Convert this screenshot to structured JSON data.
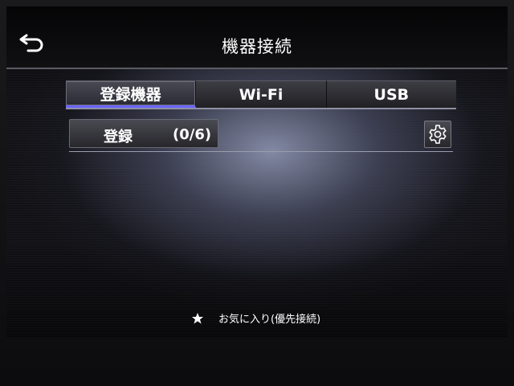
{
  "header": {
    "title": "機器接続",
    "back_icon": "back-arrow-icon"
  },
  "tabs": [
    {
      "label": "登録機器",
      "active": true
    },
    {
      "label": "Wi-Fi",
      "active": false
    },
    {
      "label": "USB",
      "active": false
    }
  ],
  "registration": {
    "label": "登録",
    "count": "(0/6)",
    "settings_icon": "gear-icon"
  },
  "legend": {
    "icon": "star-icon",
    "text": "お気に入り(優先接続)"
  },
  "colors": {
    "accent": "#6b66ff",
    "text": "#ffffff"
  }
}
